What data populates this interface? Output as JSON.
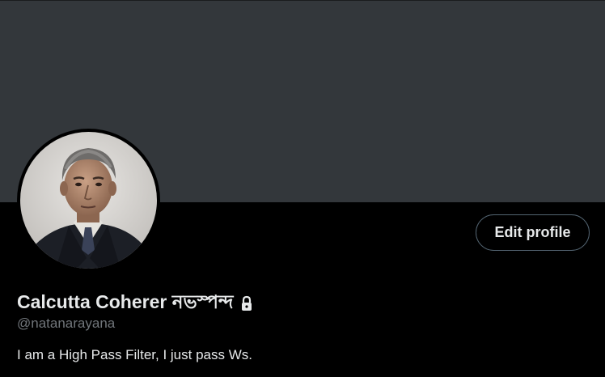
{
  "profile": {
    "display_name": "Calcutta Coherer নভস্পন্দ",
    "handle": "@natanarayana",
    "bio": "I am a High Pass Filter, I just pass Ws.",
    "edit_button_label": "Edit profile",
    "protected_icon": "lock-icon",
    "avatar": "profile-photo"
  },
  "colors": {
    "background": "#000000",
    "banner": "#33373b",
    "primary_text": "#e7e9ea",
    "secondary_text": "#71767b",
    "button_border": "#536471"
  }
}
